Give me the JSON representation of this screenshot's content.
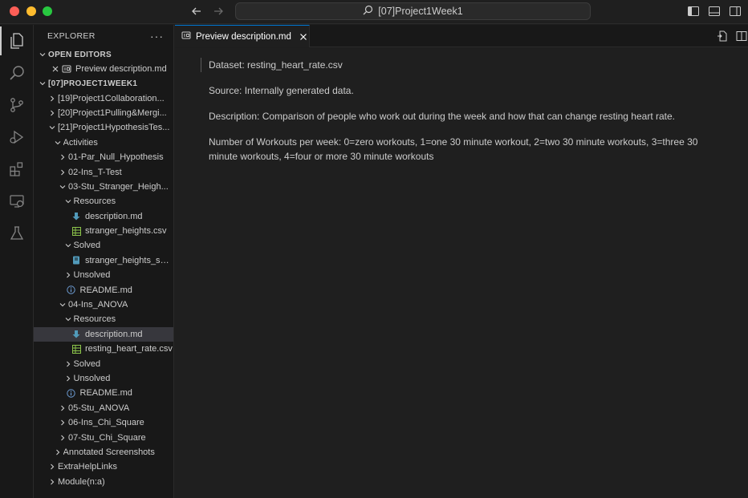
{
  "window": {
    "title": "[07]Project1Week1"
  },
  "explorer": {
    "title": "EXPLORER",
    "more": "···",
    "open_editors_title": "OPEN EDITORS",
    "open_editor_item": "Preview description.md",
    "folder_title": "[07]PROJECT1WEEK1",
    "tree": [
      {
        "label": "[19]Project1Collaboration...",
        "indent": 0,
        "kind": "folder-closed"
      },
      {
        "label": "[20]Project1Pulling&Mergi...",
        "indent": 0,
        "kind": "folder-closed"
      },
      {
        "label": "[21]Project1HypothesisTes...",
        "indent": 0,
        "kind": "folder-open"
      },
      {
        "label": "Activities",
        "indent": 1,
        "kind": "folder-open"
      },
      {
        "label": "01-Par_Null_Hypothesis",
        "indent": 2,
        "kind": "folder-closed"
      },
      {
        "label": "02-Ins_T-Test",
        "indent": 2,
        "kind": "folder-closed"
      },
      {
        "label": "03-Stu_Stranger_Heigh...",
        "indent": 2,
        "kind": "folder-open"
      },
      {
        "label": "Resources",
        "indent": 3,
        "kind": "folder-open"
      },
      {
        "label": "description.md",
        "indent": 4,
        "kind": "md"
      },
      {
        "label": "stranger_heights.csv",
        "indent": 4,
        "kind": "csv"
      },
      {
        "label": "Solved",
        "indent": 3,
        "kind": "folder-open"
      },
      {
        "label": "stranger_heights_sol...",
        "indent": 4,
        "kind": "nb"
      },
      {
        "label": "Unsolved",
        "indent": 3,
        "kind": "folder-closed"
      },
      {
        "label": "README.md",
        "indent": 3,
        "kind": "info"
      },
      {
        "label": "04-Ins_ANOVA",
        "indent": 2,
        "kind": "folder-open"
      },
      {
        "label": "Resources",
        "indent": 3,
        "kind": "folder-open"
      },
      {
        "label": "description.md",
        "indent": 4,
        "kind": "md",
        "selected": true
      },
      {
        "label": "resting_heart_rate.csv",
        "indent": 4,
        "kind": "csv"
      },
      {
        "label": "Solved",
        "indent": 3,
        "kind": "folder-closed"
      },
      {
        "label": "Unsolved",
        "indent": 3,
        "kind": "folder-closed"
      },
      {
        "label": "README.md",
        "indent": 3,
        "kind": "info"
      },
      {
        "label": "05-Stu_ANOVA",
        "indent": 2,
        "kind": "folder-closed"
      },
      {
        "label": "06-Ins_Chi_Square",
        "indent": 2,
        "kind": "folder-closed"
      },
      {
        "label": "07-Stu_Chi_Square",
        "indent": 2,
        "kind": "folder-closed"
      },
      {
        "label": "Annotated Screenshots",
        "indent": 1,
        "kind": "folder-closed"
      },
      {
        "label": "ExtraHelpLinks",
        "indent": 0,
        "kind": "folder-closed"
      },
      {
        "label": "Module(n:a)",
        "indent": 0,
        "kind": "folder-closed"
      }
    ]
  },
  "editor": {
    "tab_label": "Preview description.md",
    "paragraphs": [
      "Dataset: resting_heart_rate.csv",
      "Source: Internally generated data.",
      "Description: Comparison of people who work out during the week and how that can change resting heart rate.",
      "Number of Workouts per week: 0=zero workouts, 1=one 30 minute workout, 2=two 30 minute workouts, 3=three 30 minute workouts, 4=four or more 30 minute workouts"
    ]
  },
  "colors": {
    "accent": "#0078d4",
    "csv_icon": "#8bc34a",
    "md_icon": "#519aba",
    "info_icon": "#6c9bd2"
  }
}
